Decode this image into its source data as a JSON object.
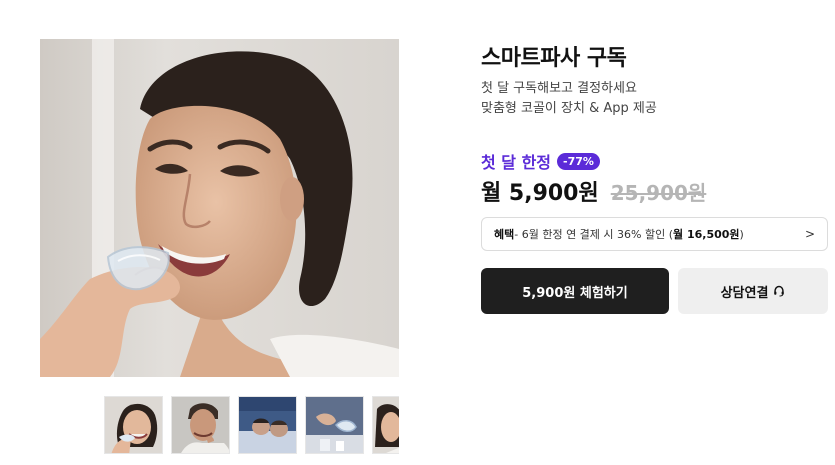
{
  "product": {
    "title": "스마트파사 구독",
    "subtitle_line1": "첫 달 구독해보고 결정하세요",
    "subtitle_line2": "맞춤형 코골이 장치 & App 제공"
  },
  "promo": {
    "label": "첫 달 한정",
    "badge": "-77%",
    "accent_color": "#5b2bd8"
  },
  "price": {
    "current": "월 5,900원",
    "original": "25,900원"
  },
  "benefit": {
    "label": "혜택",
    "text": " - 6월 한정 연 결제 시 36% 할인 (",
    "highlight": "월 16,500원",
    "close": ")",
    "arrow": ">"
  },
  "actions": {
    "trial_label": "5,900원 체험하기",
    "consult_label": "상담연결",
    "consult_icon": "headset-icon"
  },
  "gallery": {
    "main_image": "woman-holding-mouthguard-photo",
    "thumbnails": [
      "woman-mouthguard-thumb",
      "man-mouthguard-thumb",
      "couple-sleeping-thumb",
      "hands-mouthguard-thumb",
      "woman-partial-thumb"
    ]
  }
}
